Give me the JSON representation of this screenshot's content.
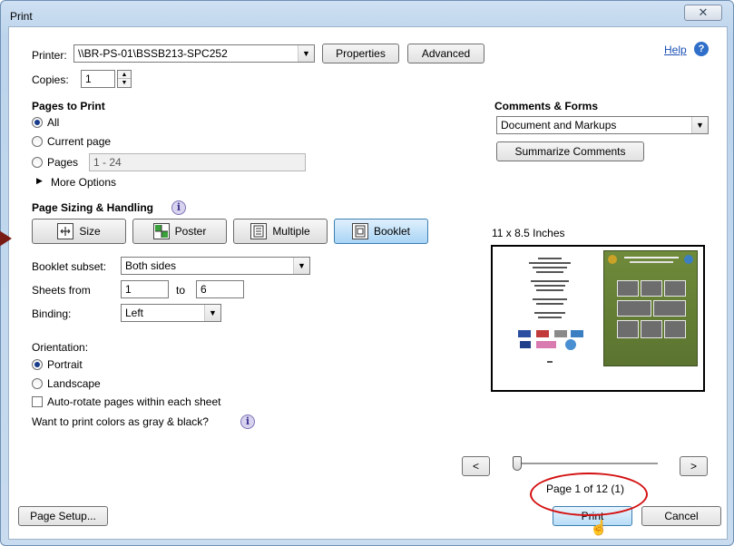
{
  "window": {
    "title": "Print",
    "close_glyph": "✕"
  },
  "printer": {
    "label": "Printer:",
    "value": "\\\\BR-PS-01\\BSSB213-SPC252",
    "properties_label": "Properties",
    "advanced_label": "Advanced",
    "help_label": "Help"
  },
  "copies": {
    "label": "Copies:",
    "value": "1"
  },
  "pages_to_print": {
    "heading": "Pages to Print",
    "all_label": "All",
    "current_label": "Current page",
    "pages_label": "Pages",
    "pages_value": "1 - 24",
    "more_options_label": "More Options",
    "selected": "All"
  },
  "sizing": {
    "heading": "Page Sizing & Handling",
    "buttons": [
      {
        "label": "Size",
        "icon": "size-icon"
      },
      {
        "label": "Poster",
        "icon": "poster-icon"
      },
      {
        "label": "Multiple",
        "icon": "multiple-icon"
      },
      {
        "label": "Booklet",
        "icon": "booklet-icon"
      }
    ],
    "active": "Booklet",
    "booklet_subset_label": "Booklet subset:",
    "booklet_subset_value": "Both sides",
    "sheets_from_label": "Sheets from",
    "sheets_from_value": "1",
    "sheets_to_label": "to",
    "sheets_to_value": "6",
    "binding_label": "Binding:",
    "binding_value": "Left"
  },
  "orientation": {
    "heading": "Orientation:",
    "portrait_label": "Portrait",
    "landscape_label": "Landscape",
    "selected": "Portrait",
    "autorotate_label": "Auto-rotate pages within each sheet",
    "autorotate_checked": false,
    "gray_label": "Want to print colors as gray & black?"
  },
  "comments": {
    "heading": "Comments & Forms",
    "value": "Document and Markups",
    "summarize_label": "Summarize Comments"
  },
  "preview": {
    "size_label": "11 x 8.5 Inches",
    "prev_label": "<",
    "next_label": ">",
    "page_status": "Page 1 of 12 (1)",
    "page_position": 0.0
  },
  "footer": {
    "page_setup_label": "Page Setup...",
    "print_label": "Print",
    "cancel_label": "Cancel"
  },
  "colors": {
    "highlight": "#d41010",
    "active_button": "#a9d4f5",
    "preview_green": "#6f8a3a"
  }
}
